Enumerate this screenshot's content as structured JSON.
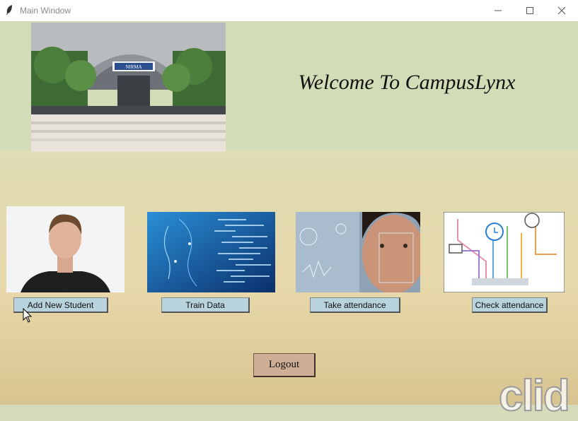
{
  "window": {
    "title": "Main Window",
    "app_icon": "feather-icon",
    "controls": [
      "minimize-icon",
      "maximize-icon",
      "close-icon"
    ]
  },
  "header": {
    "welcome_text": "Welcome To CampusLynx",
    "hero_sign_text": "NIRMA",
    "background_color": "#d2dcb6"
  },
  "features": [
    {
      "label": "Add New Student",
      "image": "student-portrait"
    },
    {
      "label": "Train Data",
      "image": "ai-face-data"
    },
    {
      "label": "Take attendance",
      "image": "face-recognition-scan"
    },
    {
      "label": "Check attendance",
      "image": "circuit-icons"
    }
  ],
  "logout_label": "Logout",
  "watermark_text": "clid",
  "colors": {
    "button_blue": "#b9d3dc",
    "logout_button": "#cfae96",
    "body_top": "#dfdcb5",
    "body_bottom": "#d7c490"
  }
}
